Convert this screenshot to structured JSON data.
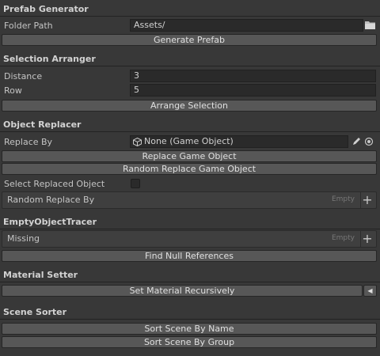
{
  "prefab_generator": {
    "title": "Prefab Generator",
    "folder_path_label": "Folder Path",
    "folder_path_value": "Assets/",
    "generate_button": "Generate Prefab"
  },
  "selection_arranger": {
    "title": "Selection Arranger",
    "distance_label": "Distance",
    "distance_value": "3",
    "row_label": "Row",
    "row_value": "5",
    "arrange_button": "Arrange Selection"
  },
  "object_replacer": {
    "title": "Object Replacer",
    "replace_by_label": "Replace By",
    "replace_by_value": "None (Game Object)",
    "replace_button": "Replace Game Object",
    "random_replace_button": "Random Replace Game Object",
    "select_replaced_label": "Select Replaced Object",
    "random_replace_by_label": "Random Replace By",
    "random_replace_by_empty": "Empty"
  },
  "empty_object_tracer": {
    "title": "EmptyObjectTracer",
    "missing_label": "Missing",
    "missing_empty": "Empty",
    "find_null_button": "Find Null References"
  },
  "material_setter": {
    "title": "Material Setter",
    "set_material_button": "Set Material Recursively"
  },
  "scene_sorter": {
    "title": "Scene Sorter",
    "sort_by_name_button": "Sort Scene By Name",
    "sort_by_group_button": "Sort Scene By Group"
  }
}
